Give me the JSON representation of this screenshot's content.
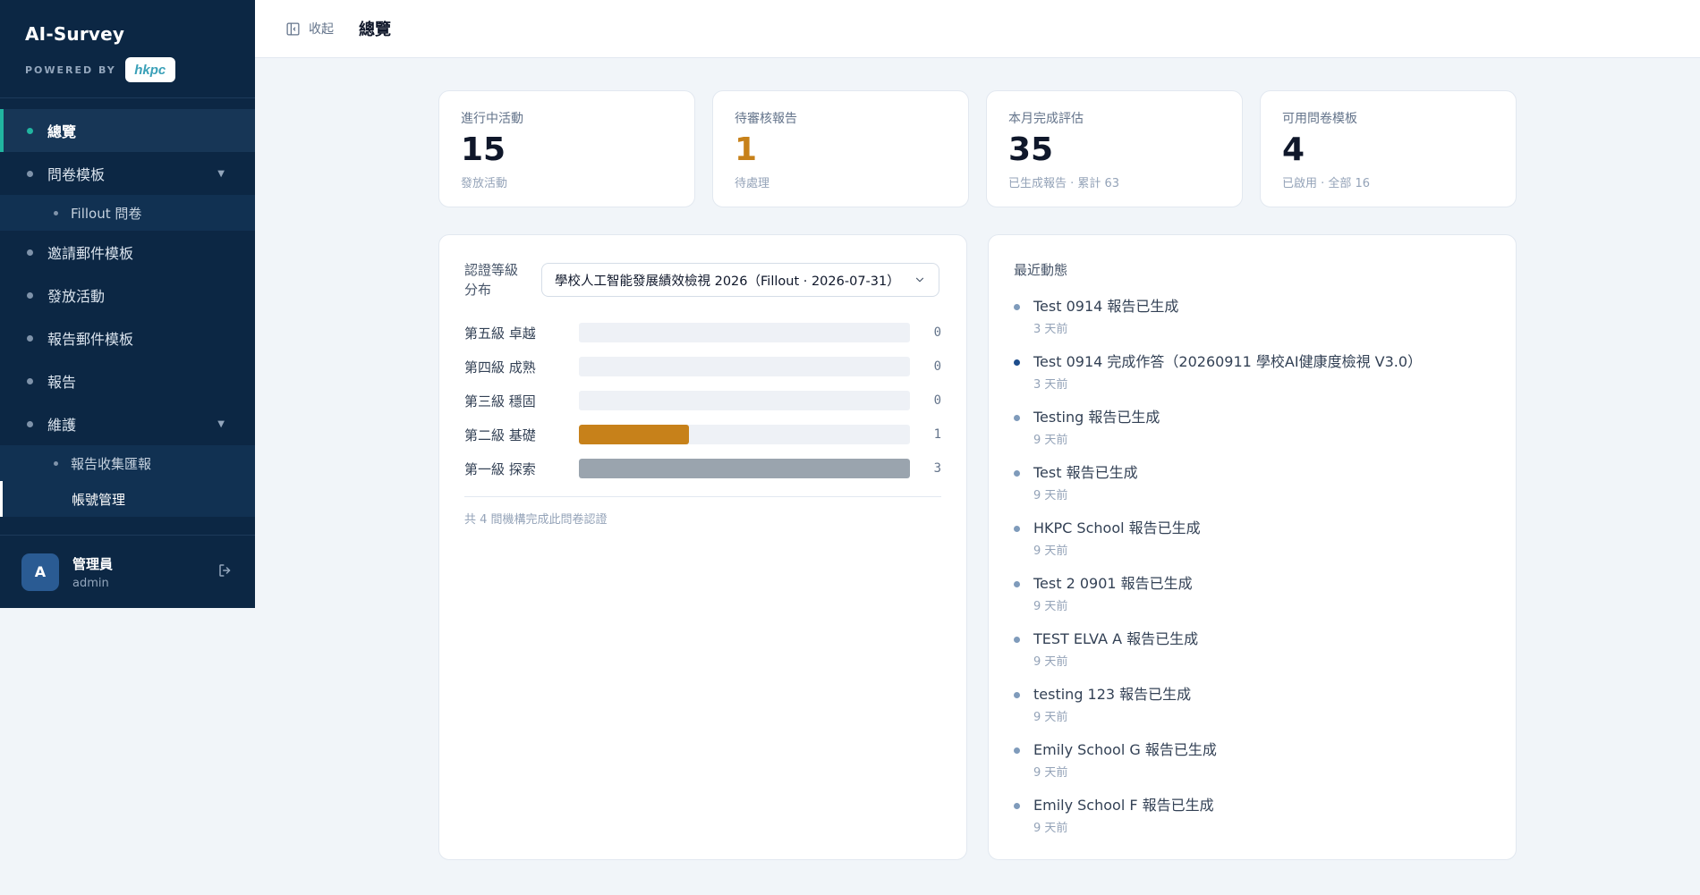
{
  "brand": {
    "title": "AI-Survey",
    "powered_by": "POWERED BY",
    "logo_text": "hkpc"
  },
  "sidebar": {
    "items": [
      {
        "label": "總覽"
      },
      {
        "label": "問卷模板"
      },
      {
        "label": "Fillout 問卷"
      },
      {
        "label": "邀請郵件模板"
      },
      {
        "label": "發放活動"
      },
      {
        "label": "報告郵件模板"
      },
      {
        "label": "報告"
      },
      {
        "label": "維護"
      },
      {
        "label": "報告收集匯報"
      },
      {
        "label": "帳號管理"
      }
    ],
    "user": {
      "initial": "A",
      "name": "管理員",
      "role": "admin"
    }
  },
  "header": {
    "collapse_label": "收起",
    "title": "總覽"
  },
  "stats": [
    {
      "label": "進行中活動",
      "value": "15",
      "sub": "發放活動",
      "color": "#0f172a"
    },
    {
      "label": "待審核報告",
      "value": "1",
      "sub": "待處理",
      "color": "#c7811a"
    },
    {
      "label": "本月完成評估",
      "value": "35",
      "sub": "已生成報告 · 累計 63",
      "color": "#0f172a"
    },
    {
      "label": "可用問卷模板",
      "value": "4",
      "sub": "已啟用 · 全部 16",
      "color": "#0f172a"
    }
  ],
  "distribution": {
    "title": "認證等級分布",
    "selected_survey": "學校人工智能發展績效檢視 2026（Fillout · 2026-07-31）",
    "footer": "共 4 間機構完成此問卷認證"
  },
  "chart_data": {
    "type": "bar",
    "orientation": "horizontal",
    "categories": [
      "第五級 卓越",
      "第四級 成熟",
      "第三級 穩固",
      "第二級 基礎",
      "第一級 探索"
    ],
    "values": [
      0,
      0,
      0,
      1,
      3
    ],
    "bar_colors": [
      "#c7811a",
      "#c7811a",
      "#c7811a",
      "#c7811a",
      "#9aa4ae"
    ],
    "xlim": [
      0,
      3
    ]
  },
  "activity": {
    "title": "最近動態",
    "items": [
      {
        "text": "Test 0914 報告已生成",
        "time": "3 天前"
      },
      {
        "text": "Test 0914 完成作答（20260911 學校AI健康度檢視 V3.0）",
        "time": "3 天前"
      },
      {
        "text": "Testing 報告已生成",
        "time": "9 天前"
      },
      {
        "text": "Test 報告已生成",
        "time": "9 天前"
      },
      {
        "text": "HKPC School 報告已生成",
        "time": "9 天前"
      },
      {
        "text": "Test 2 0901 報告已生成",
        "time": "9 天前"
      },
      {
        "text": "TEST ELVA A 報告已生成",
        "time": "9 天前"
      },
      {
        "text": "testing 123 報告已生成",
        "time": "9 天前"
      },
      {
        "text": "Emily School G 報告已生成",
        "time": "9 天前"
      },
      {
        "text": "Emily School F 報告已生成",
        "time": "9 天前"
      }
    ]
  }
}
